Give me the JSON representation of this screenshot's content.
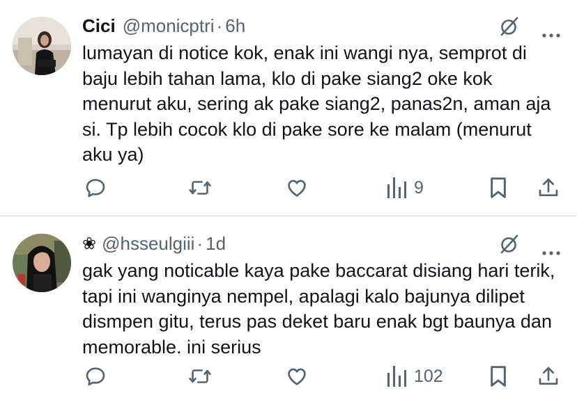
{
  "colors": {
    "text": "#0f1419",
    "secondary": "#536471",
    "divider": "#cfd9de",
    "background": "#ffffff"
  },
  "tweets": [
    {
      "display_name": "Cici",
      "handle": "@monicptri",
      "separator": "·",
      "time": "6h",
      "emoji": "",
      "text": "lumayan di notice kok, enak ini wangi nya, semprot di baju lebih tahan lama, klo di pake siang2 oke kok menurut aku, sering ak pake siang2, panas2n, aman aja si. Tp lebih cocok klo di pake sore ke malam (menurut aku ya)",
      "views": "9",
      "icons": [
        "grok-icon",
        "more-icon",
        "reply-icon",
        "retweet-icon",
        "like-icon",
        "views-icon",
        "bookmark-icon",
        "share-icon"
      ]
    },
    {
      "display_name": "",
      "handle": "@hsseulgiii",
      "separator": "·",
      "time": "1d",
      "emoji": "❀",
      "text": "gak yang noticable kaya pake baccarat disiang hari terik, tapi ini wanginya nempel, apalagi kalo bajunya dilipet dismpen gitu, terus pas deket baru enak bgt baunya dan memorable. ini serius",
      "views": "102",
      "icons": [
        "grok-icon",
        "more-icon",
        "reply-icon",
        "retweet-icon",
        "like-icon",
        "views-icon",
        "bookmark-icon",
        "share-icon"
      ]
    }
  ]
}
